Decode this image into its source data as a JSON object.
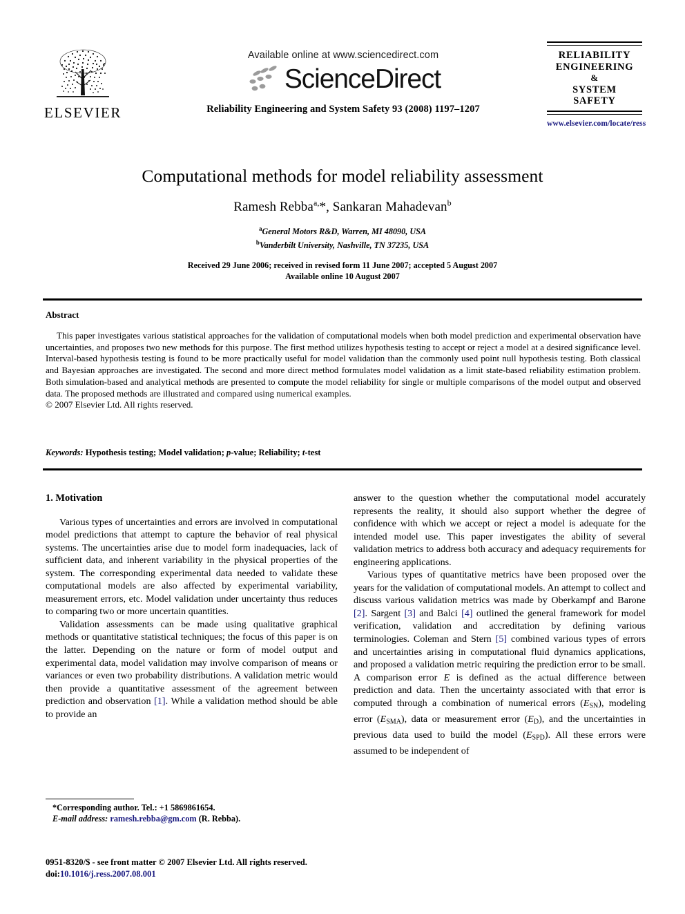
{
  "masthead": {
    "publisher_name": "ELSEVIER",
    "publisher_logo_icon": "elsevier-tree-icon",
    "available_online": "Available online at www.sciencedirect.com",
    "sciencedirect_wordmark": "ScienceDirect",
    "sciencedirect_dots_icon": "sciencedirect-dots-icon",
    "journal_reference": "Reliability Engineering and System Safety 93 (2008) 1197–1207",
    "journal_logo": {
      "line1": "RELIABILITY",
      "line2": "ENGINEERING",
      "line3": "&",
      "line4": "SYSTEM",
      "line5": "SAFETY",
      "url": "www.elsevier.com/locate/ress"
    }
  },
  "article": {
    "title": "Computational methods for model reliability assessment",
    "authors_html": "Ramesh Rebba<sup>a,</sup>*, Sankaran Mahadevan<sup>b</sup>",
    "authors_text": "Ramesh Rebba a,*, Sankaran Mahadevan b",
    "affiliation_a": "General Motors R&D, Warren, MI 48090, USA",
    "affiliation_b": "Vanderbilt University, Nashville, TN 37235, USA",
    "dates_line1": "Received 29 June 2006; received in revised form 11 June 2007; accepted 5 August 2007",
    "dates_line2": "Available online 10 August 2007"
  },
  "abstract": {
    "heading": "Abstract",
    "body": "This paper investigates various statistical approaches for the validation of computational models when both model prediction and experimental observation have uncertainties, and proposes two new methods for this purpose. The first method utilizes hypothesis testing to accept or reject a model at a desired significance level. Interval-based hypothesis testing is found to be more practically useful for model validation than the commonly used point null hypothesis testing. Both classical and Bayesian approaches are investigated. The second and more direct method formulates model validation as a limit state-based reliability estimation problem. Both simulation-based and analytical methods are presented to compute the model reliability for single or multiple comparisons of the model output and observed data. The proposed methods are illustrated and compared using numerical examples.",
    "copyright": "© 2007 Elsevier Ltd. All rights reserved."
  },
  "keywords": {
    "label": "Keywords:",
    "items_text": "Hypothesis testing; Model validation; p-value; Reliability; t-test",
    "part1": " Hypothesis testing; Model validation; ",
    "italic1": "p",
    "part2": "-value; Reliability; ",
    "italic2": "t",
    "part3": "-test"
  },
  "section1": {
    "heading": "1. Motivation",
    "left_p1": "Various types of uncertainties and errors are involved in computational model predictions that attempt to capture the behavior of real physical systems. The uncertainties arise due to model form inadequacies, lack of sufficient data, and inherent variability in the physical properties of the system. The corresponding experimental data needed to validate these computational models are also affected by experimental variability, measurement errors, etc. Model validation under uncertainty thus reduces to comparing two or more uncertain quantities.",
    "left_p2_a": "Validation assessments can be made using qualitative graphical methods or quantitative statistical techniques; the focus of this paper is on the latter. Depending on the nature or form of model output and experimental data, model validation may involve comparison of means or variances or even two probability distributions. A validation metric would then provide a quantitative assessment of the agreement between prediction and observation ",
    "left_p2_ref": "[1]",
    "left_p2_b": ". While a validation method should be able to provide an",
    "right_p1": "answer to the question whether the computational model accurately represents the reality, it should also support whether the degree of confidence with which we accept or reject a model is adequate for the intended model use. This paper investigates the ability of several validation metrics to address both accuracy and adequacy requirements for engineering applications.",
    "right_p2_a": "Various types of quantitative metrics have been proposed over the years for the validation of computational models. An attempt to collect and discuss various validation metrics was made by Oberkampf and Barone ",
    "right_p2_ref1": "[2]",
    "right_p2_b": ". Sargent ",
    "right_p2_ref2": "[3]",
    "right_p2_c": " and Balci ",
    "right_p2_ref3": "[4]",
    "right_p2_d": " outlined the general framework for model verification, validation and accreditation by defining various terminologies. Coleman and Stern ",
    "right_p2_ref4": "[5]",
    "right_p2_e": " combined various types of errors and uncertainties arising in computational fluid dynamics applications, and proposed a validation metric requiring the prediction error to be small. A comparison error ",
    "right_p2_var1": "E",
    "right_p2_f": " is defined as the actual difference between prediction and data. Then the uncertainty associated with that error is computed through a combination of numerical errors (",
    "right_p2_var2": "E",
    "right_p2_sub2": "SN",
    "right_p2_g": "), modeling error (",
    "right_p2_var3": "E",
    "right_p2_sub3": "SMA",
    "right_p2_h": "), data or measurement error (",
    "right_p2_var4": "E",
    "right_p2_sub4": "D",
    "right_p2_i": "), and the uncertainties in previous data used to build the model (",
    "right_p2_var5": "E",
    "right_p2_sub5": "SPD",
    "right_p2_j": "). All these errors were assumed to be independent of"
  },
  "footnote": {
    "corresponding": "*Corresponding author. Tel.: +1 5869861654.",
    "email_label": "E-mail address:",
    "email": "ramesh.rebba@gm.com",
    "email_suffix": " (R. Rebba)."
  },
  "footer": {
    "issn_line": "0951-8320/$ - see front matter © 2007 Elsevier Ltd. All rights reserved.",
    "doi_label": "doi:",
    "doi_value": "10.1016/j.ress.2007.08.001"
  },
  "colors": {
    "link": "#1a1a80",
    "text": "#000000",
    "background": "#ffffff"
  }
}
